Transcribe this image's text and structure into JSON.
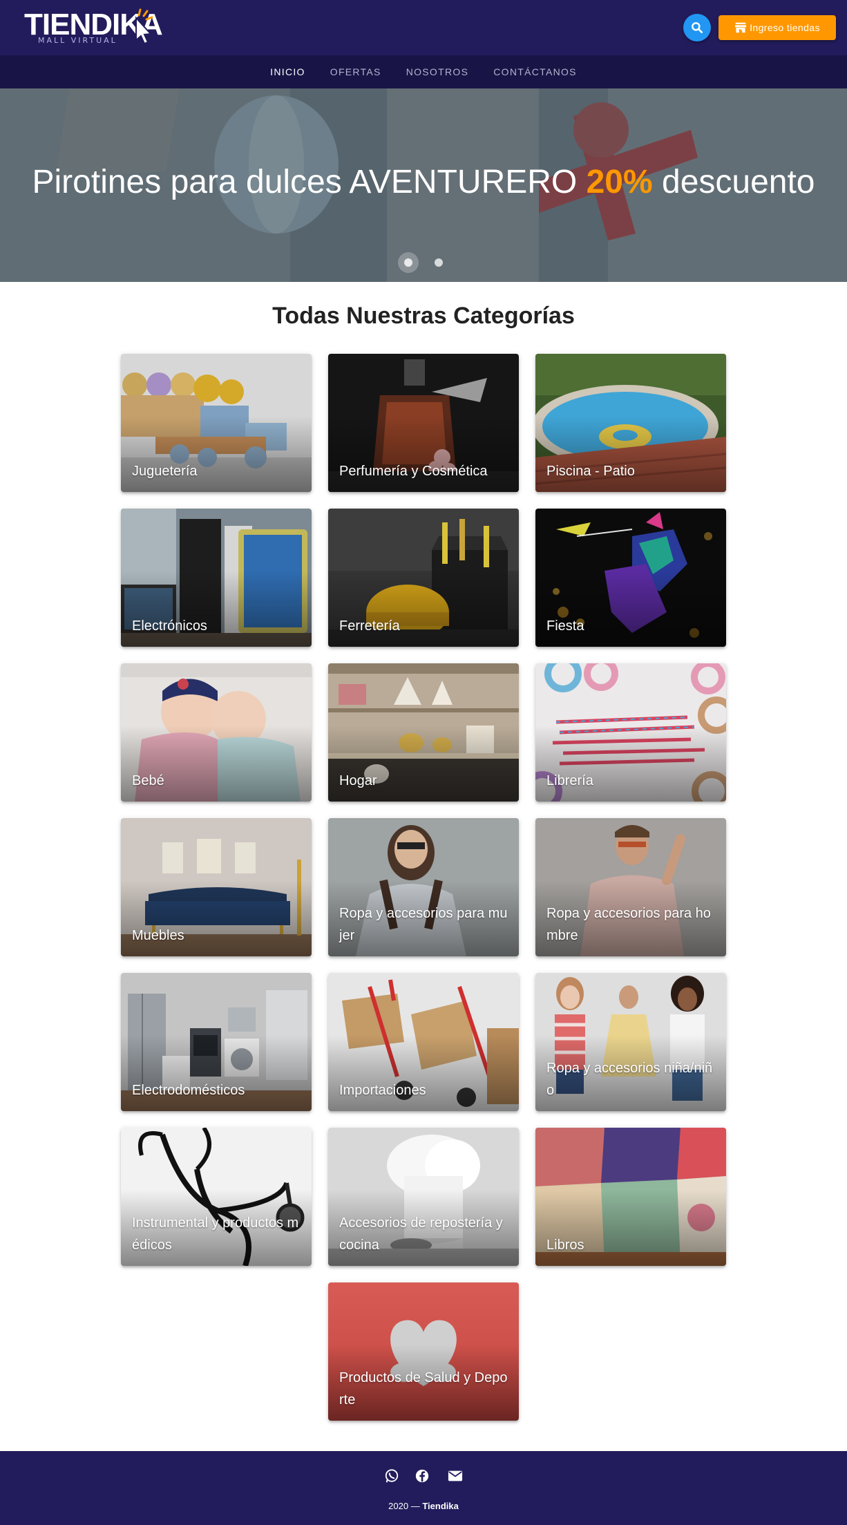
{
  "header": {
    "logo_text": "TIENDIK",
    "logo_k": "A",
    "logo_subtitle": "MALL VIRTUAL",
    "search_icon": "search-icon",
    "store_button_label": "Ingreso tiendas",
    "store_icon": "store-icon"
  },
  "nav": {
    "items": [
      "INICIO",
      "OFERTAS",
      "NOSOTROS",
      "CONTÁCTANOS"
    ],
    "active": "INICIO"
  },
  "hero": {
    "text_before": "Pirotines para dulces AVENTURERO ",
    "highlight": "20%",
    "text_after": " descuento",
    "slides_count": 2,
    "active_slide": 1
  },
  "categories": {
    "title": "Todas Nuestras Categorías",
    "items": [
      "Juguetería",
      "Perfumería y Cosmética",
      "Piscina - Patio",
      "Electrónicos",
      "Ferretería",
      "Fiesta",
      "Bebé",
      "Hogar",
      "Librería",
      "Muebles",
      "Ropa y accesorios para mujer",
      "Ropa y accesorios para hombre",
      "Electrodomésticos",
      "Importaciones",
      "Ropa y accesorios niña/niño",
      "Instrumental y productos médicos",
      "Accesorios de repostería y cocina",
      "Libros",
      "Productos de Salud y Deporte"
    ]
  },
  "footer": {
    "icons": [
      "whatsapp-icon",
      "facebook-icon",
      "email-icon"
    ],
    "year": "2020 —",
    "brand": "Tiendika"
  },
  "colors": {
    "header_bg": "#221c5c",
    "nav_bg": "#181446",
    "accent_orange": "#ff9800",
    "accent_blue": "#2196f3"
  }
}
